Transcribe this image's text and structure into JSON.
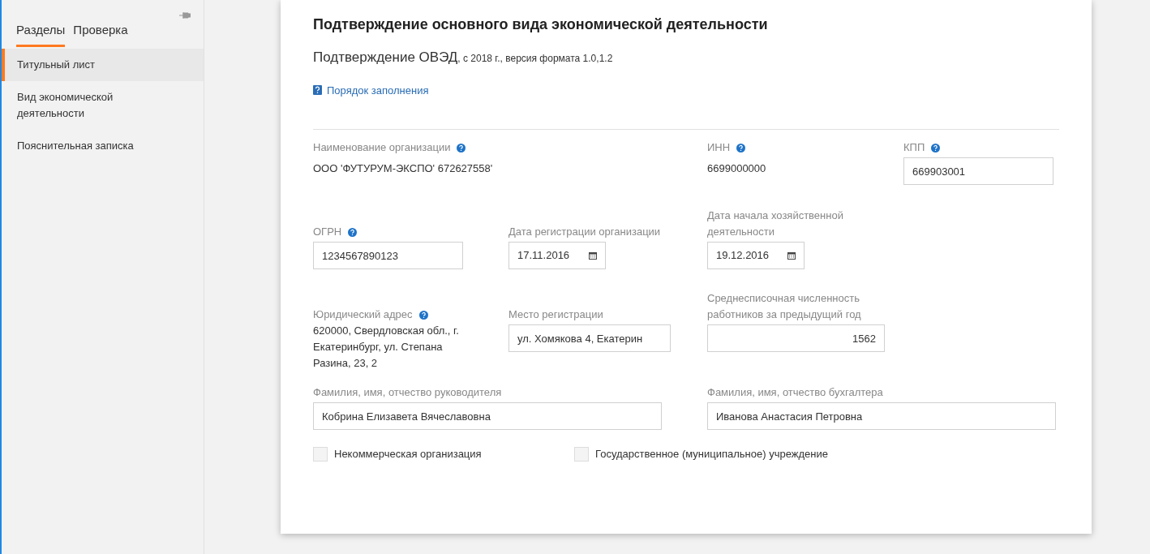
{
  "sidebar": {
    "tabs": [
      {
        "label": "Разделы",
        "selected": true
      },
      {
        "label": "Проверка",
        "selected": false
      }
    ],
    "items": [
      {
        "label": "Титульный лист",
        "selected": true
      },
      {
        "label": "Вид экономической деятельности",
        "selected": false
      },
      {
        "label": "Пояснительная записка",
        "selected": false
      }
    ]
  },
  "form": {
    "title": "Подтверждение основного вида экономической деятельности",
    "subtitle": "Подтверждение ОВЭД",
    "subtitle_note": ", с 2018 г., версия формата 1.0,1.2",
    "help_link": "Порядок заполнения",
    "rows": [
      [
        {
          "kind": "static",
          "label": "Наименование организации",
          "help": true,
          "value": "ООО 'ФУТУРУМ-ЭКСПО' 672627558'"
        },
        {
          "kind": "empty"
        },
        {
          "kind": "static",
          "label": "ИНН",
          "help": true,
          "value": "6699000000"
        },
        {
          "kind": "input",
          "label": "КПП",
          "help": true,
          "value": "669903001"
        }
      ],
      [
        {
          "kind": "input",
          "label": "ОГРН",
          "help": true,
          "value": "1234567890123"
        },
        {
          "kind": "date",
          "label": "Дата регистрации организации",
          "help": false,
          "value": "17.11.2016"
        },
        {
          "kind": "date",
          "label": "Дата начала хозяйственной деятельности",
          "help": false,
          "value": "19.12.2016"
        }
      ],
      [
        {
          "kind": "static",
          "label": "Юридический адрес",
          "help": true,
          "value": "620000, Свердловская обл., г. Екатеринбург, ул. Степана Разина, 23, 2"
        },
        {
          "kind": "input",
          "label": "Место регистрации",
          "help": false,
          "value": "ул. Хомякова 4, Екатерин"
        },
        {
          "kind": "number",
          "label": "Среднесписочная численность работников за предыдущий год",
          "help": false,
          "value": "1562"
        }
      ]
    ],
    "wide_fields": [
      {
        "label": "Фамилия, имя, отчество руководителя",
        "value": "Кобрина Елизавета Вячеславовна"
      },
      {
        "label": "Фамилия, имя, отчество бухгалтера",
        "value": "Иванова Анастасия Петровна"
      }
    ],
    "checkboxes": [
      {
        "label": "Некоммерческая организация",
        "checked": false
      },
      {
        "label": "Государственное (муниципальное) учреждение",
        "checked": false
      }
    ]
  }
}
